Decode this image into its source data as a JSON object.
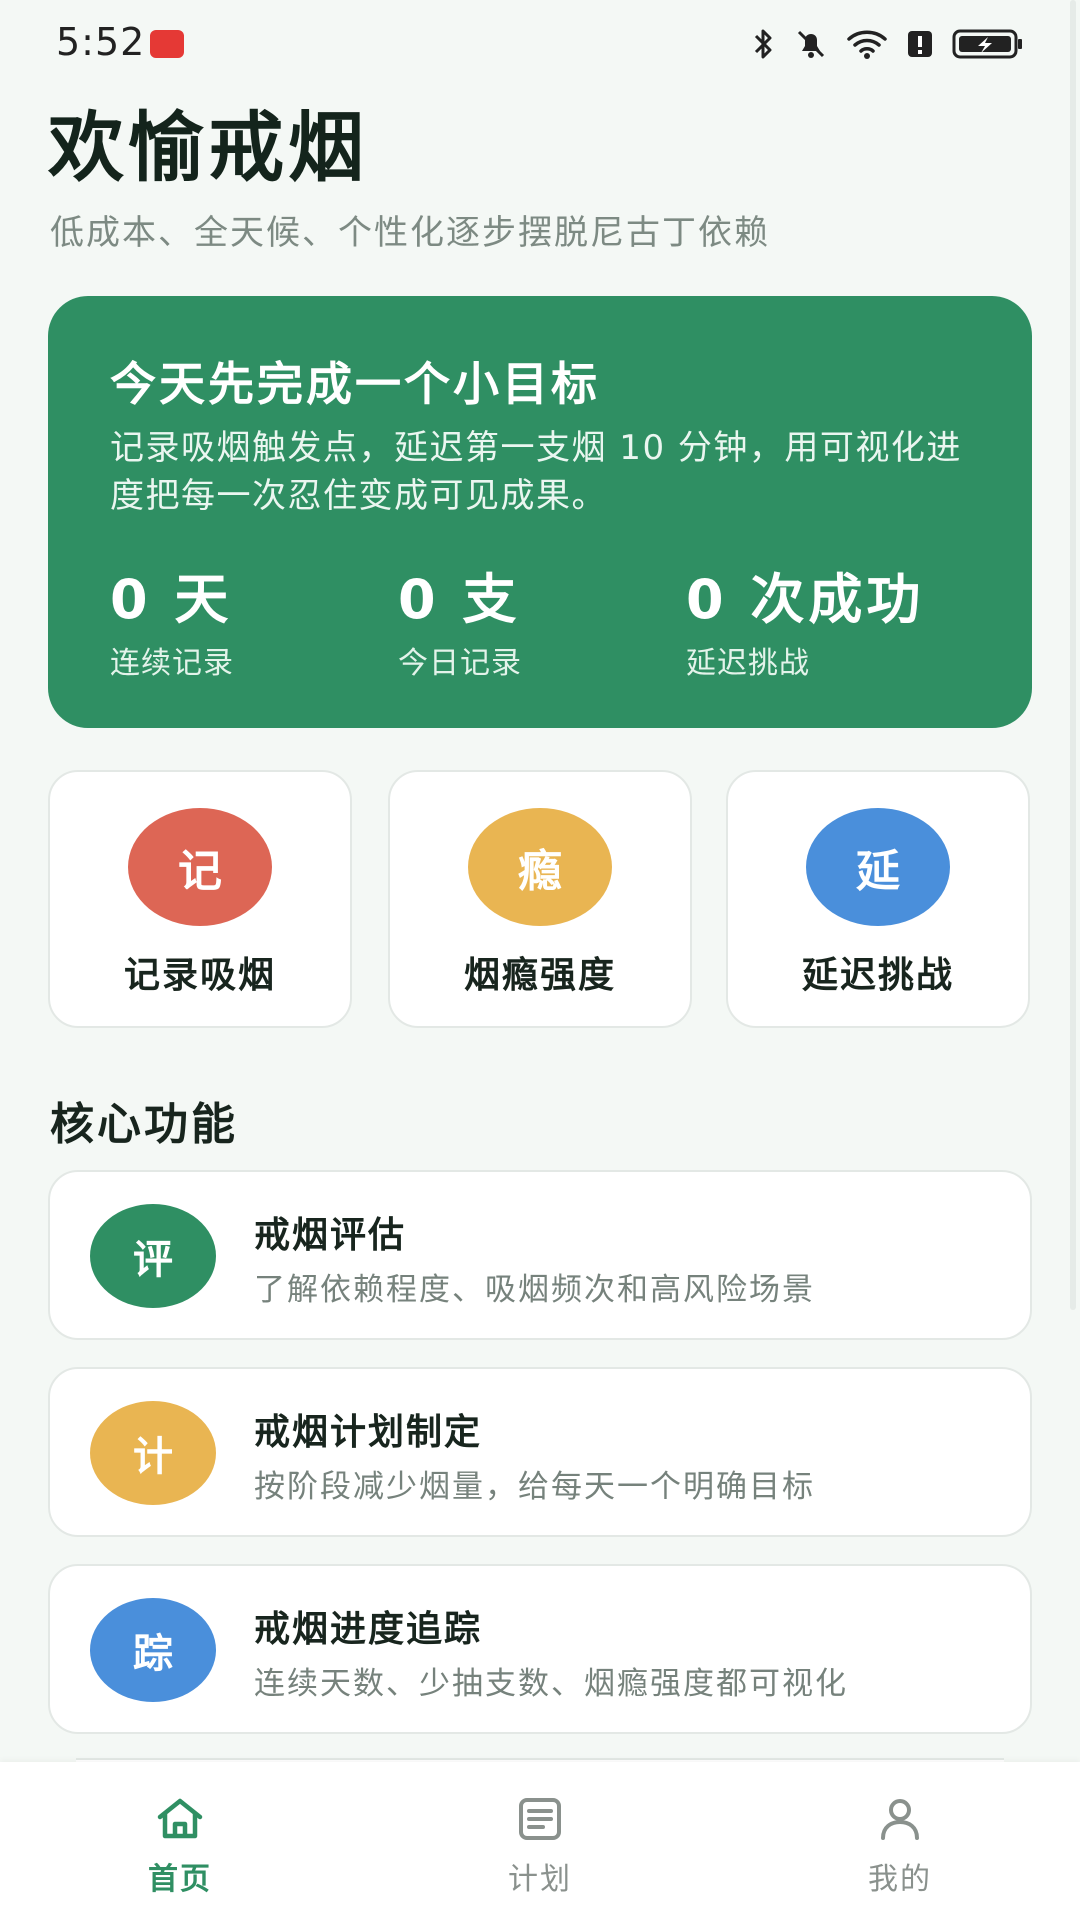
{
  "status_bar": {
    "time": "5:52"
  },
  "header": {
    "title": "欢愉戒烟",
    "subtitle": "低成本、全天候、个性化逐步摆脱尼古丁依赖"
  },
  "hero": {
    "title": "今天先完成一个小目标",
    "description": "记录吸烟触发点，延迟第一支烟 10 分钟，用可视化进度把每一次忍住变成可见成果。",
    "stats": [
      {
        "value": "0 天",
        "label": "连续记录"
      },
      {
        "value": "0 支",
        "label": "今日记录"
      },
      {
        "value": "0 次成功",
        "label": "延迟挑战"
      }
    ],
    "background_color": "#2f8f63"
  },
  "quick_actions": [
    {
      "glyph": "记",
      "label": "记录吸烟",
      "color": "#dd6655"
    },
    {
      "glyph": "瘾",
      "label": "烟瘾强度",
      "color": "#e9b552"
    },
    {
      "glyph": "延",
      "label": "延迟挑战",
      "color": "#4a8fdb"
    }
  ],
  "section": {
    "title": "核心功能"
  },
  "features": [
    {
      "glyph": "评",
      "title": "戒烟评估",
      "description": "了解依赖程度、吸烟频次和高风险场景",
      "color": "#2f8f63"
    },
    {
      "glyph": "计",
      "title": "戒烟计划制定",
      "description": "按阶段减少烟量，给每天一个明确目标",
      "color": "#e9b552"
    },
    {
      "glyph": "踪",
      "title": "戒烟进度追踪",
      "description": "连续天数、少抽支数、烟瘾强度都可视化",
      "color": "#4a8fdb"
    }
  ],
  "bottom_nav": [
    {
      "label": "首页",
      "icon": "home-icon",
      "active": true
    },
    {
      "label": "计划",
      "icon": "document-icon",
      "active": false
    },
    {
      "label": "我的",
      "icon": "person-icon",
      "active": false
    }
  ],
  "colors": {
    "accent": "#2f8f63",
    "inactive": "#8a918d"
  }
}
